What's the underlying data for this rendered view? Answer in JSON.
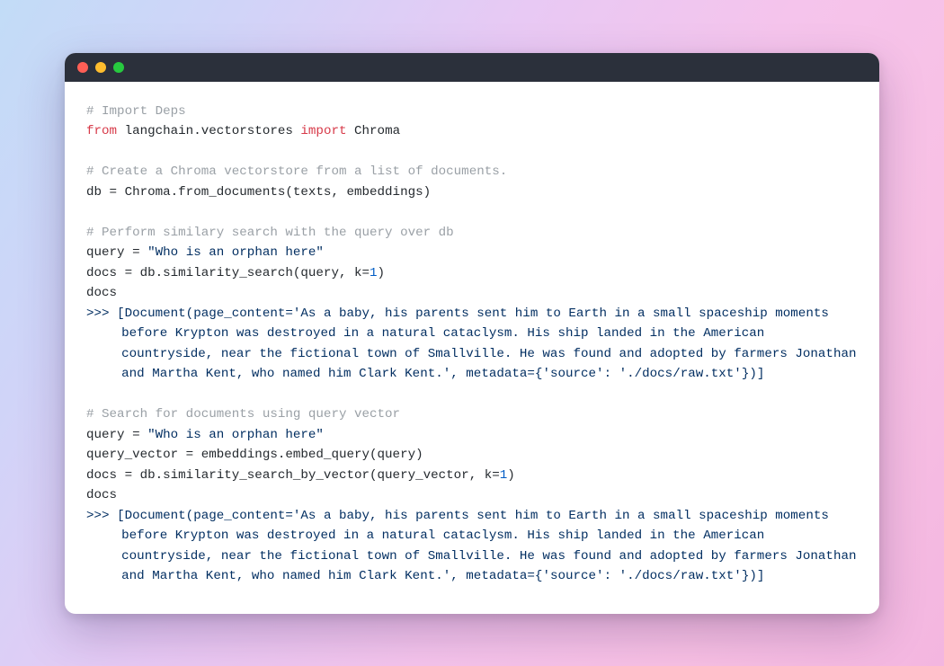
{
  "code": {
    "comment1": "# Import Deps",
    "kw_from": "from",
    "module": " langchain.vectorstores ",
    "kw_import": "import",
    "import_name": " Chroma",
    "comment2": "# Create a Chroma vectorstore from a list of documents.",
    "line_db": "db = Chroma.from_documents(texts, embeddings)",
    "comment3": "# Perform similary search with the query over db",
    "q1_lhs": "query = ",
    "q1_str": "\"Who is an orphan here\"",
    "docs1_a": "docs = db.similarity_search(query, k=",
    "docs1_num": "1",
    "docs1_b": ")",
    "docs_var": "docs",
    "prompt": ">>> ",
    "out_pre": "[Document(page_content=",
    "out_str": "'As a baby, his parents sent him to Earth in a small spaceship moments before Krypton was destroyed in a natural cataclysm. His ship landed in the American countryside, near the fictional town of Smallville. He was found and adopted by farmers Jonathan and Martha Kent, who named him Clark Kent.'",
    "out_mid": ", metadata={",
    "out_meta_k": "'source'",
    "out_mid2": ": ",
    "out_meta_v": "'./docs/raw.txt'",
    "out_suf": "})]",
    "comment4": "# Search for documents using query vector",
    "q2_lhs": "query = ",
    "q2_str": "\"Who is an orphan here\"",
    "qvec": "query_vector = embeddings.embed_query(query)",
    "docs2_a": "docs = db.similarity_search_by_vector(query_vector, k=",
    "docs2_num": "1",
    "docs2_b": ")"
  }
}
